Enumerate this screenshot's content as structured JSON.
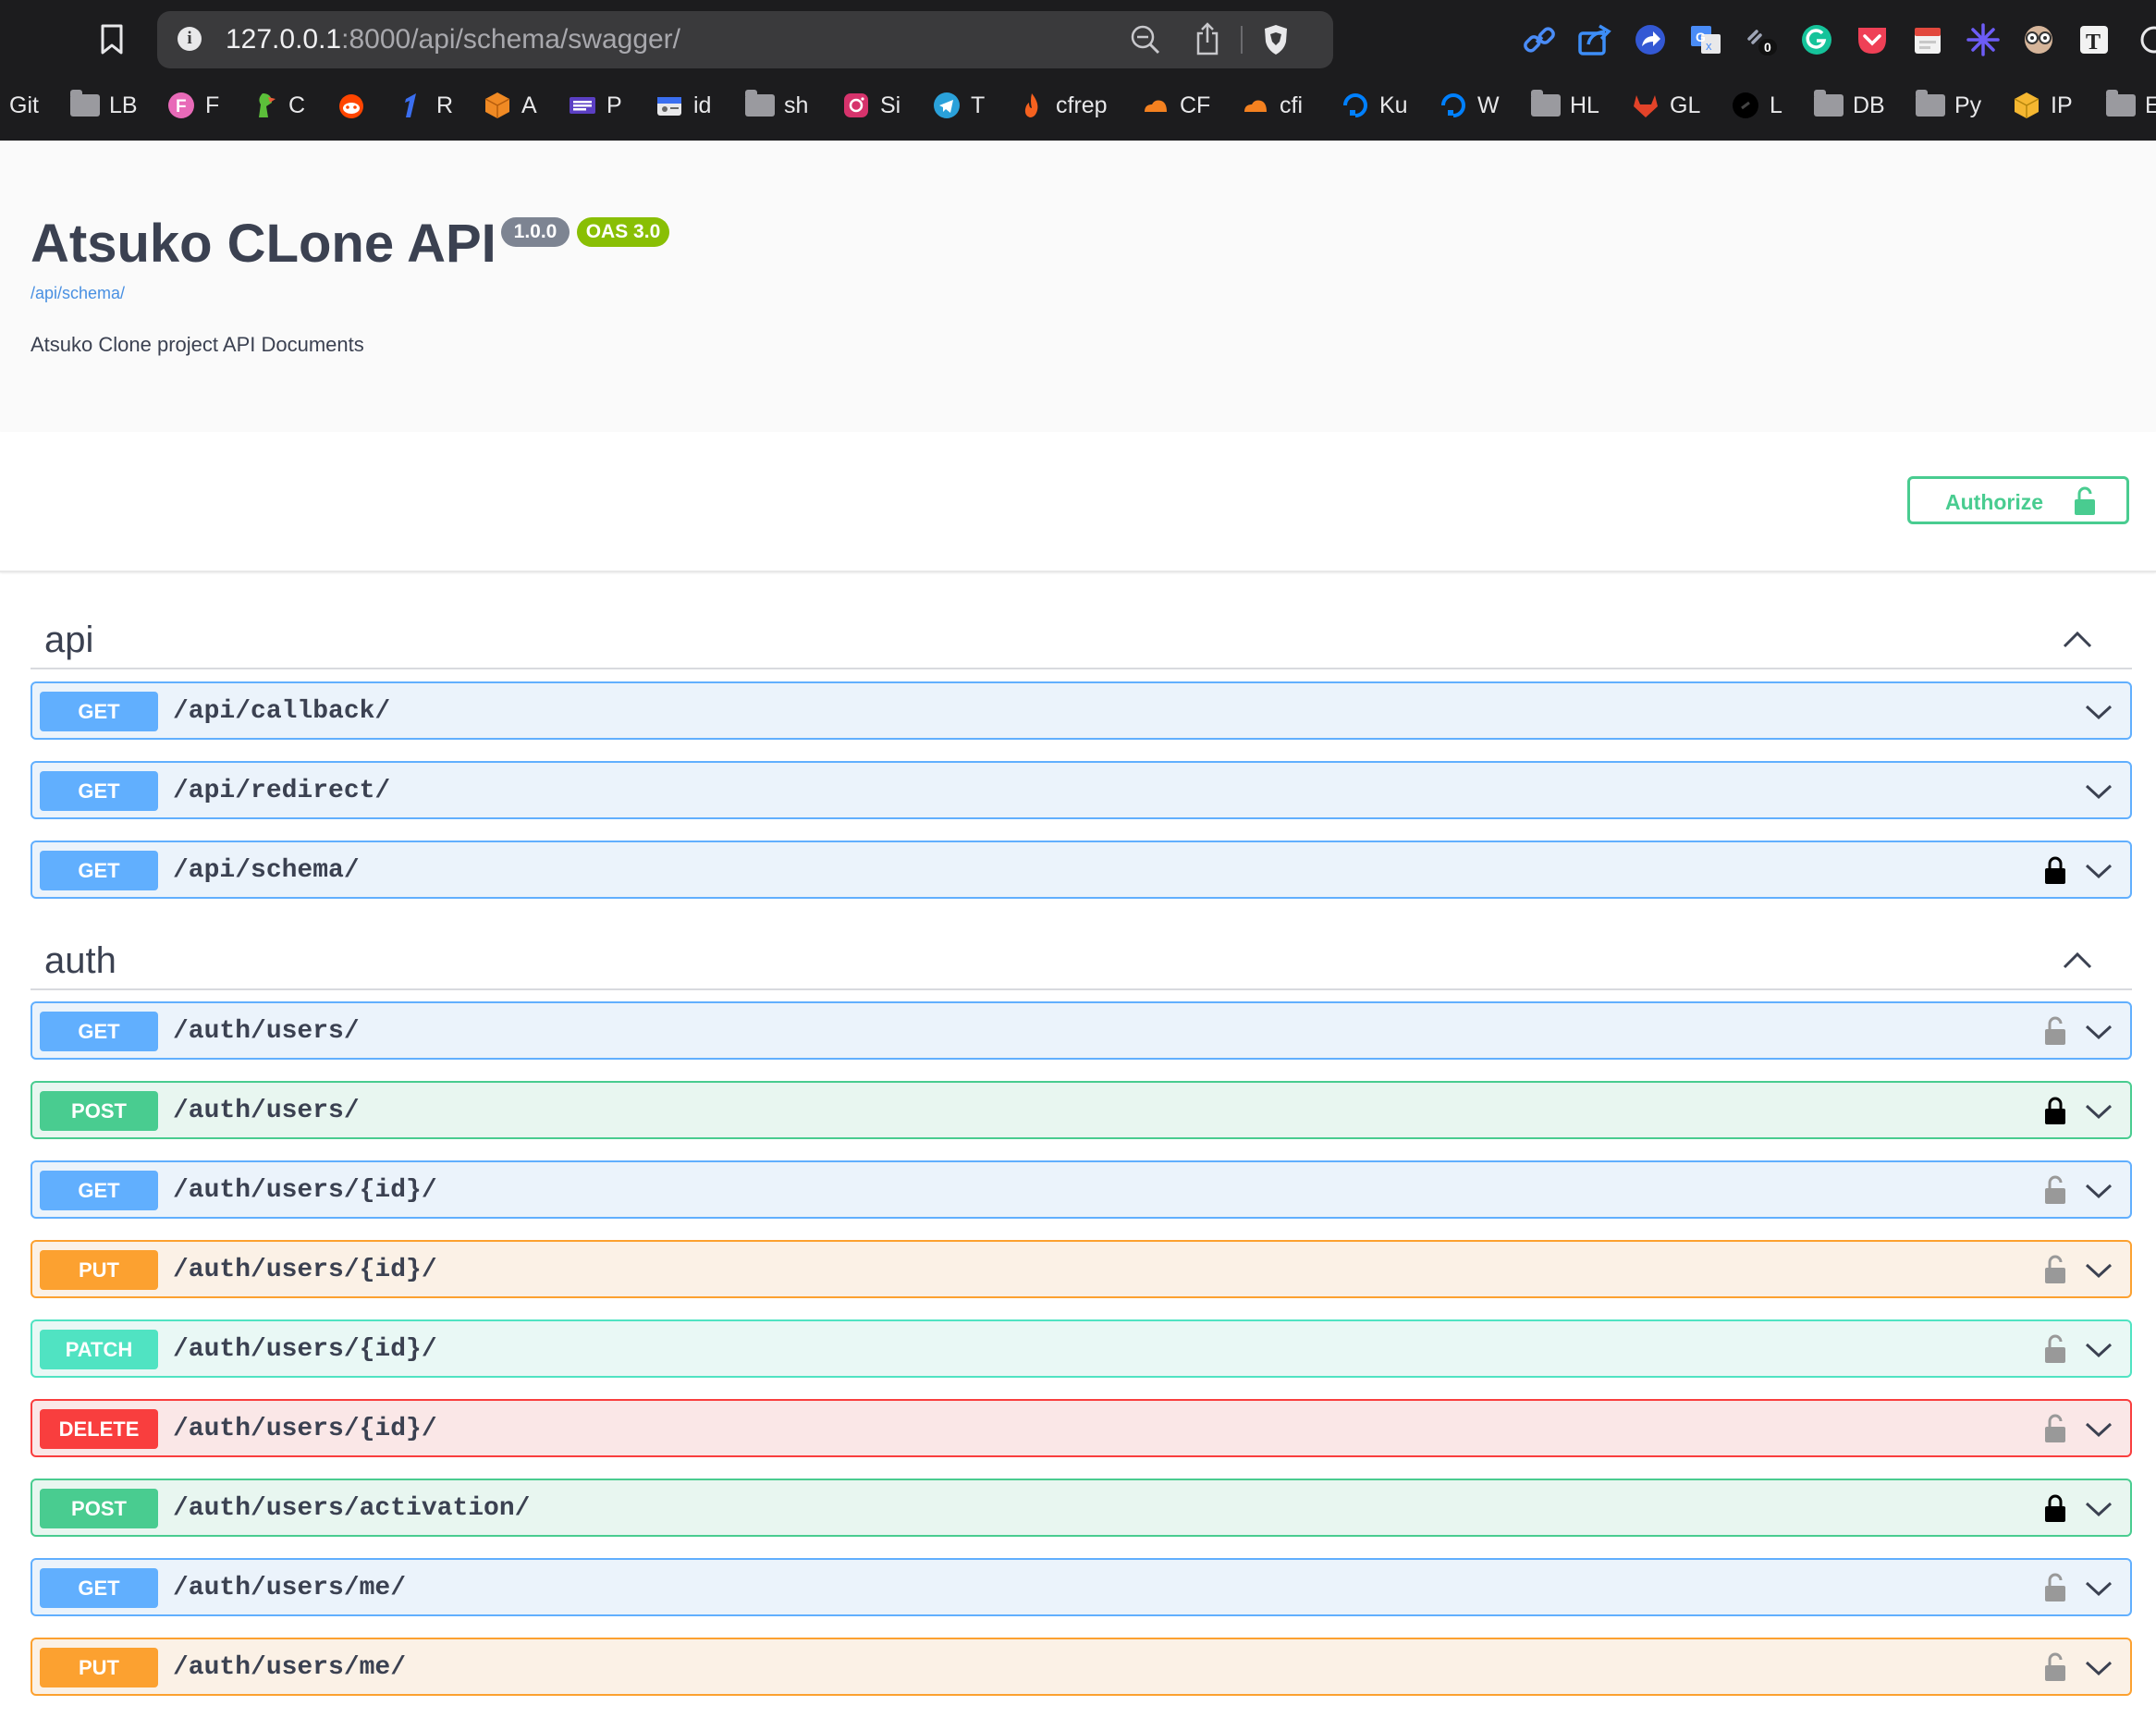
{
  "browser": {
    "url_host": "127.0.0.1",
    "url_rest": ":8000/api/schema/swagger/",
    "bookmarks": [
      {
        "label": "Git",
        "icon": "none"
      },
      {
        "label": "LB",
        "icon": "folder"
      },
      {
        "label": "F",
        "icon": "pink-f-icon"
      },
      {
        "label": "C",
        "icon": "parrot-icon"
      },
      {
        "label": "",
        "icon": "reddit-icon"
      },
      {
        "label": "R",
        "icon": "blue-one-icon"
      },
      {
        "label": "A",
        "icon": "orange-cube-icon"
      },
      {
        "label": "P",
        "icon": "purple-list-icon"
      },
      {
        "label": "id",
        "icon": "id-card-icon"
      },
      {
        "label": "sh",
        "icon": "folder"
      },
      {
        "label": "Si",
        "icon": "instagram-icon"
      },
      {
        "label": "T",
        "icon": "telegram-icon"
      },
      {
        "label": "cfrep",
        "icon": "flame-icon"
      },
      {
        "label": "CF",
        "icon": "cloudflare-icon"
      },
      {
        "label": "cfi",
        "icon": "cloudflare-icon"
      },
      {
        "label": "Ku",
        "icon": "digitalocean-icon"
      },
      {
        "label": "W",
        "icon": "digitalocean-icon"
      },
      {
        "label": "HL",
        "icon": "folder"
      },
      {
        "label": "GL",
        "icon": "gitlab-icon"
      },
      {
        "label": "L",
        "icon": "link-circle-icon"
      },
      {
        "label": "DB",
        "icon": "folder"
      },
      {
        "label": "Py",
        "icon": "folder"
      },
      {
        "label": "IP",
        "icon": "yellow-cube-icon"
      },
      {
        "label": "E",
        "icon": "folder"
      }
    ],
    "extension_badge": "0"
  },
  "info": {
    "title": "Atsuko CLone API",
    "version": "1.0.0",
    "oas": "OAS 3.0",
    "schema_url": "/api/schema/",
    "description": "Atsuko Clone project API Documents"
  },
  "authorize": {
    "label": "Authorize"
  },
  "sections": [
    {
      "name": "api",
      "operations": [
        {
          "method": "GET",
          "path": "/api/callback/",
          "lock": "none"
        },
        {
          "method": "GET",
          "path": "/api/redirect/",
          "lock": "none"
        },
        {
          "method": "GET",
          "path": "/api/schema/",
          "lock": "locked"
        }
      ]
    },
    {
      "name": "auth",
      "operations": [
        {
          "method": "GET",
          "path": "/auth/users/",
          "lock": "unlocked"
        },
        {
          "method": "POST",
          "path": "/auth/users/",
          "lock": "locked"
        },
        {
          "method": "GET",
          "path": "/auth/users/{id}/",
          "lock": "unlocked"
        },
        {
          "method": "PUT",
          "path": "/auth/users/{id}/",
          "lock": "unlocked"
        },
        {
          "method": "PATCH",
          "path": "/auth/users/{id}/",
          "lock": "unlocked"
        },
        {
          "method": "DELETE",
          "path": "/auth/users/{id}/",
          "lock": "unlocked"
        },
        {
          "method": "POST",
          "path": "/auth/users/activation/",
          "lock": "locked"
        },
        {
          "method": "GET",
          "path": "/auth/users/me/",
          "lock": "unlocked"
        },
        {
          "method": "PUT",
          "path": "/auth/users/me/",
          "lock": "unlocked"
        }
      ]
    }
  ],
  "colors": {
    "get": "#61affe",
    "post": "#49cc90",
    "put": "#fca130",
    "patch": "#50e3c2",
    "delete": "#f93e3e",
    "version_badge": "#7d8492",
    "oas_badge": "#89bf04"
  }
}
